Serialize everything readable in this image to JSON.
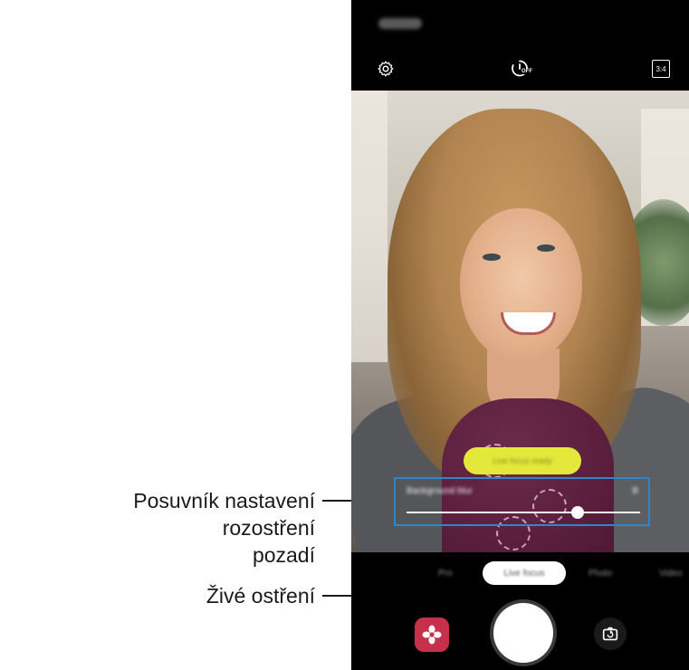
{
  "callouts": {
    "blur_slider_label_line1": "Posuvník nastavení rozostření",
    "blur_slider_label_line2": "pozadí",
    "live_focus_label": "Živé ostření"
  },
  "top_bar": {
    "settings_icon": "gear-icon",
    "timer_icon": "timer-off-icon",
    "timer_text": "OFF",
    "ratio_label": "3:4"
  },
  "viewfinder": {
    "accent_yellow": "#e3e83a",
    "highlight_border": "#2c86c9"
  },
  "bottom": {
    "gallery_icon": "flower-gallery-icon",
    "gallery_color": "#c7304a",
    "shutter_icon": "shutter-icon",
    "switch_camera_icon": "switch-camera-icon"
  }
}
